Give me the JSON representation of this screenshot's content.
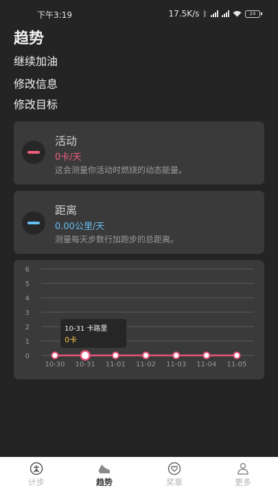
{
  "status_bar": {
    "time": "下午3:19",
    "speed": "17.5K/s",
    "battery": "24"
  },
  "header": {
    "title": "趋势"
  },
  "menu": {
    "keep_going": "继续加油",
    "edit_info": "修改信息",
    "edit_goal": "修改目标"
  },
  "activity_card": {
    "title": "活动",
    "value": "0卡/天",
    "description": "这会测量你活动时燃烧的动态能量。",
    "accent_color": "#f0607e"
  },
  "distance_card": {
    "title": "距离",
    "value": "0.00公里/天",
    "description": "测量每天步数行加跑步的总距离。",
    "accent_color": "#66bff2"
  },
  "chart_data": {
    "type": "line",
    "categories": [
      "10-30",
      "10-31",
      "11-01",
      "11-02",
      "11-03",
      "11-04",
      "11-05"
    ],
    "values": [
      0,
      0,
      0,
      0,
      0,
      0,
      0
    ],
    "ylim": [
      0,
      6
    ],
    "yticks": [
      "0",
      "1",
      "2",
      "3",
      "4",
      "5",
      "6"
    ],
    "grid": true,
    "line_color": "#e8547a",
    "highlight_index": 1,
    "tooltip": {
      "title": "10-31 卡路里",
      "value": "0卡"
    }
  },
  "tabbar": {
    "items": [
      {
        "label": "计步",
        "icon": "step-counter-icon",
        "active": false
      },
      {
        "label": "趋势",
        "icon": "sneaker-icon",
        "active": true
      },
      {
        "label": "奖章",
        "icon": "heart-medal-icon",
        "active": false
      },
      {
        "label": "更多",
        "icon": "person-more-icon",
        "active": false
      }
    ]
  }
}
